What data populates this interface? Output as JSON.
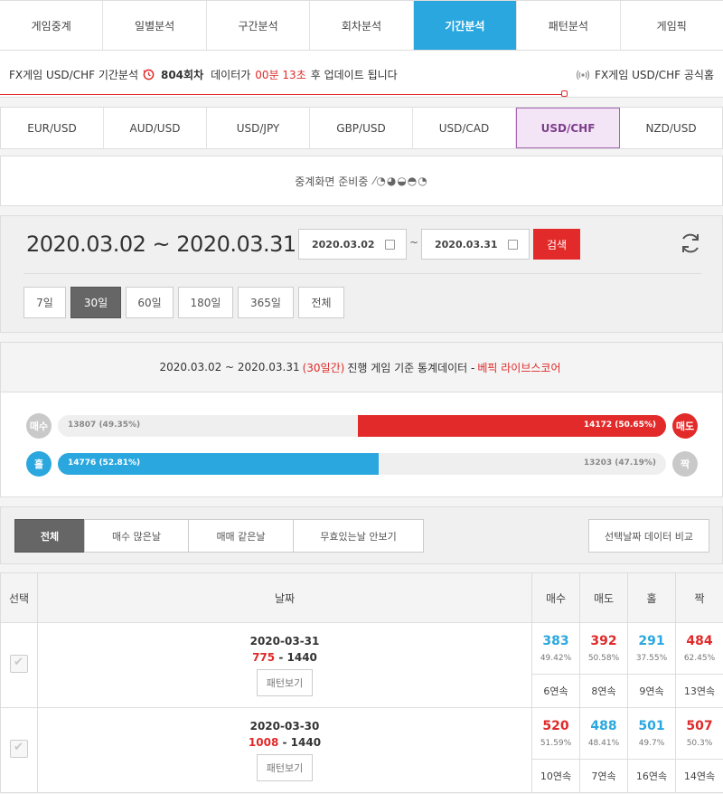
{
  "tabs": [
    {
      "label": "게임중계",
      "active": false
    },
    {
      "label": "일별분석",
      "active": false
    },
    {
      "label": "구간분석",
      "active": false
    },
    {
      "label": "회차분석",
      "active": false
    },
    {
      "label": "기간분석",
      "active": true
    },
    {
      "label": "패턴분석",
      "active": false
    },
    {
      "label": "게임픽",
      "active": false
    }
  ],
  "info": {
    "prefix": "FX게임 USD/CHF 기간분석",
    "round": "804회차",
    "mid": "데이터가",
    "timer": "00분 13초",
    "suffix": "후 업데이트 됩니다",
    "official": "FX게임 USD/CHF 공식홈"
  },
  "pairs": [
    {
      "label": "EUR/USD",
      "active": false
    },
    {
      "label": "AUD/USD",
      "active": false
    },
    {
      "label": "USD/JPY",
      "active": false
    },
    {
      "label": "GBP/USD",
      "active": false
    },
    {
      "label": "USD/CAD",
      "active": false
    },
    {
      "label": "USD/CHF",
      "active": true
    },
    {
      "label": "NZD/USD",
      "active": false
    }
  ],
  "broadcast": {
    "text": "중계화면 준비중",
    "dots": "⁄◔◕◒◓◔"
  },
  "range": {
    "title": "2020.03.02 ~ 2020.03.31",
    "start": "2020.03.02",
    "tilde": "~",
    "end": "2020.03.31",
    "search": "검색",
    "periods": [
      {
        "label": "7일",
        "active": false
      },
      {
        "label": "30일",
        "active": true
      },
      {
        "label": "60일",
        "active": false
      },
      {
        "label": "180일",
        "active": false
      },
      {
        "label": "365일",
        "active": false
      },
      {
        "label": "전체",
        "active": false
      }
    ]
  },
  "stats": {
    "head_range": "2020.03.02 ~ 2020.03.31",
    "head_days": "(30일간)",
    "head_mid": "진행 게임 기준 통계데이터 -",
    "head_brand": "베픽 라이브스코어",
    "buy_label": "매수",
    "sell_label": "매도",
    "buy_text": "13807 (49.35%)",
    "sell_text": "14172 (50.65%)",
    "sell_pct": 50.65,
    "odd_label": "홀",
    "even_label": "짝",
    "odd_text": "14776 (52.81%)",
    "even_text": "13203 (47.19%)",
    "odd_pct": 52.81,
    "colors": {
      "red": "#e32a2a",
      "blue": "#2ba7df",
      "gray": "#c9c9c9"
    }
  },
  "filters": {
    "all": "전체",
    "more_buy": "매수 많은날",
    "equal": "매매 같은날",
    "hide_void": "무효있는날 안보기",
    "compare": "선택날짜 데이터 비교"
  },
  "table": {
    "headers": {
      "select": "선택",
      "date": "날짜",
      "buy": "매수",
      "sell": "매도",
      "odd": "홀",
      "even": "짝"
    },
    "pattern_label": "패턴보기",
    "rows": [
      {
        "date": "2020-03-31",
        "cur": "775",
        "sep": "-",
        "total": "1440",
        "buy": "383",
        "buy_pct": "49.42%",
        "buy_streak": "6연속",
        "sell": "392",
        "sell_pct": "50.58%",
        "sell_streak": "8연속",
        "odd": "291",
        "odd_pct": "37.55%",
        "odd_streak": "9연속",
        "even": "484",
        "even_pct": "62.45%",
        "even_streak": "13연속"
      },
      {
        "date": "2020-03-30",
        "cur": "1008",
        "sep": "-",
        "total": "1440",
        "buy": "520",
        "buy_pct": "51.59%",
        "buy_streak": "10연속",
        "sell": "488",
        "sell_pct": "48.41%",
        "sell_streak": "7연속",
        "odd": "501",
        "odd_pct": "49.7%",
        "odd_streak": "16연속",
        "even": "507",
        "even_pct": "50.3%",
        "even_streak": "14연속"
      }
    ]
  }
}
